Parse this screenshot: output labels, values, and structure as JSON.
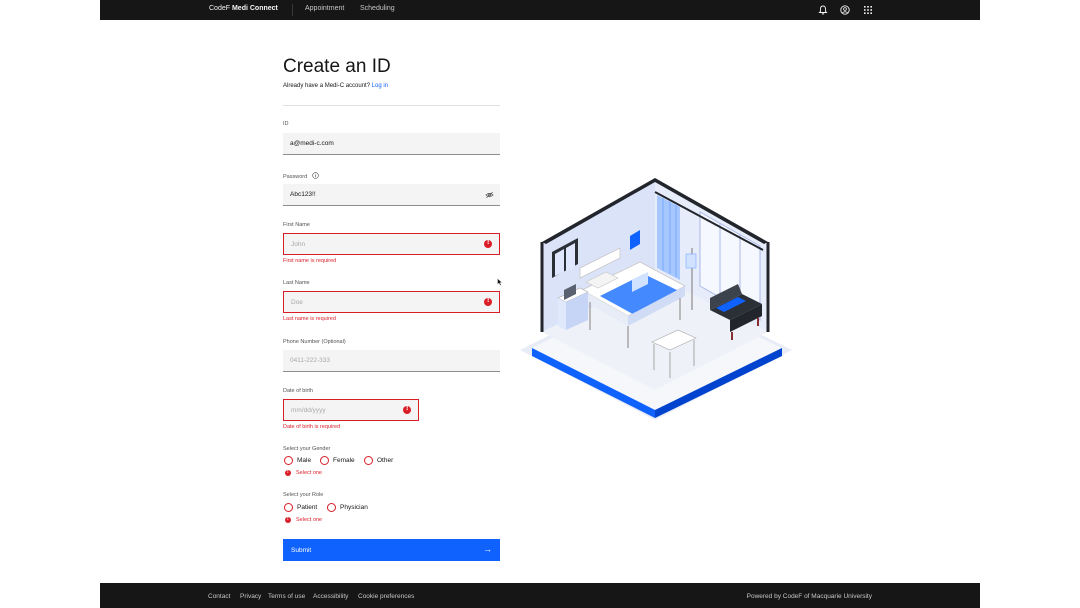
{
  "header": {
    "brand_prefix": "CodeF",
    "brand_name": "Medi Connect",
    "nav": [
      "Appointment",
      "Scheduling"
    ],
    "icons": [
      "notification-icon",
      "user-avatar-icon",
      "app-switcher-icon"
    ]
  },
  "form": {
    "title": "Create an ID",
    "subtitle_text": "Already have a Medi-C account?",
    "login_link": "Log in",
    "id_label": "ID",
    "id_value": "a@medi-c.com",
    "password_label": "Password",
    "password_value": "Abc123!!",
    "first_name_label": "First Name",
    "first_name_placeholder": "John",
    "first_name_error": "First name is required",
    "last_name_label": "Last Name",
    "last_name_placeholder": "Doe",
    "last_name_error": "Last name is required",
    "phone_label": "Phone Number (Optional)",
    "phone_placeholder": "0411-222-333",
    "dob_label": "Date of birth",
    "dob_placeholder": "mm/dd/yyyy",
    "dob_error": "Date of birth is required",
    "gender_label": "Select your Gender",
    "gender_options": [
      "Male",
      "Female",
      "Other"
    ],
    "gender_error": "Select one",
    "role_label": "Select your Role",
    "role_options": [
      "Patient",
      "Physician"
    ],
    "role_error": "Select one",
    "submit_label": "Submit"
  },
  "colors": {
    "header_bg": "#161616",
    "primary": "#0f62fe",
    "error": "#da1e28",
    "field_bg": "#f4f4f4"
  },
  "footer": {
    "links": [
      "Contact",
      "Privacy",
      "Terms of use",
      "Accessibility",
      "Cookie preferences"
    ],
    "powered": "Powered by CodeF of Macquarie University"
  }
}
